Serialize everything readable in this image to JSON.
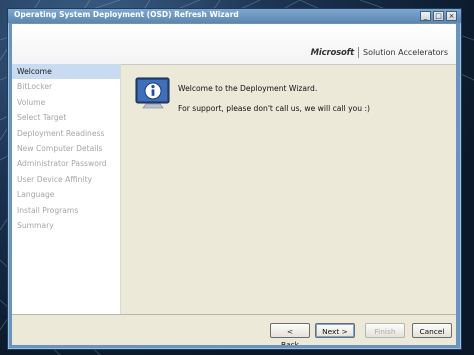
{
  "window": {
    "title": "Operating System Deployment (OSD) Refresh Wizard",
    "buttons": {
      "minimize": "_",
      "maximize": "□",
      "close": "×"
    }
  },
  "banner": {
    "brand_name": "Microsoft",
    "brand_product": "Solution Accelerators"
  },
  "sidebar": {
    "items": [
      {
        "label": "Welcome",
        "state": "active"
      },
      {
        "label": "BitLocker",
        "state": "disabled"
      },
      {
        "label": "Volume",
        "state": "disabled"
      },
      {
        "label": "Select Target",
        "state": "disabled"
      },
      {
        "label": "Deployment Readiness",
        "state": "disabled"
      },
      {
        "label": "New Computer Details",
        "state": "disabled"
      },
      {
        "label": "Administrator Password",
        "state": "disabled"
      },
      {
        "label": "User Device Affinity",
        "state": "disabled"
      },
      {
        "label": "Language",
        "state": "disabled"
      },
      {
        "label": "Install Programs",
        "state": "disabled"
      },
      {
        "label": "Summary",
        "state": "disabled"
      }
    ]
  },
  "content": {
    "icon": "info-monitor-icon",
    "welcome_text": "Welcome to the Deployment Wizard.",
    "support_text": "For support, please don't call us, we will call you :)"
  },
  "footer": {
    "back_label": "< Back",
    "next_label": "Next >",
    "finish_label": "Finish",
    "cancel_label": "Cancel"
  },
  "colors": {
    "titlebar": "#6b94ba",
    "active_nav": "#c8dbf0",
    "disabled_text": "#a6a6a6",
    "window_bg": "#ece9d8"
  }
}
